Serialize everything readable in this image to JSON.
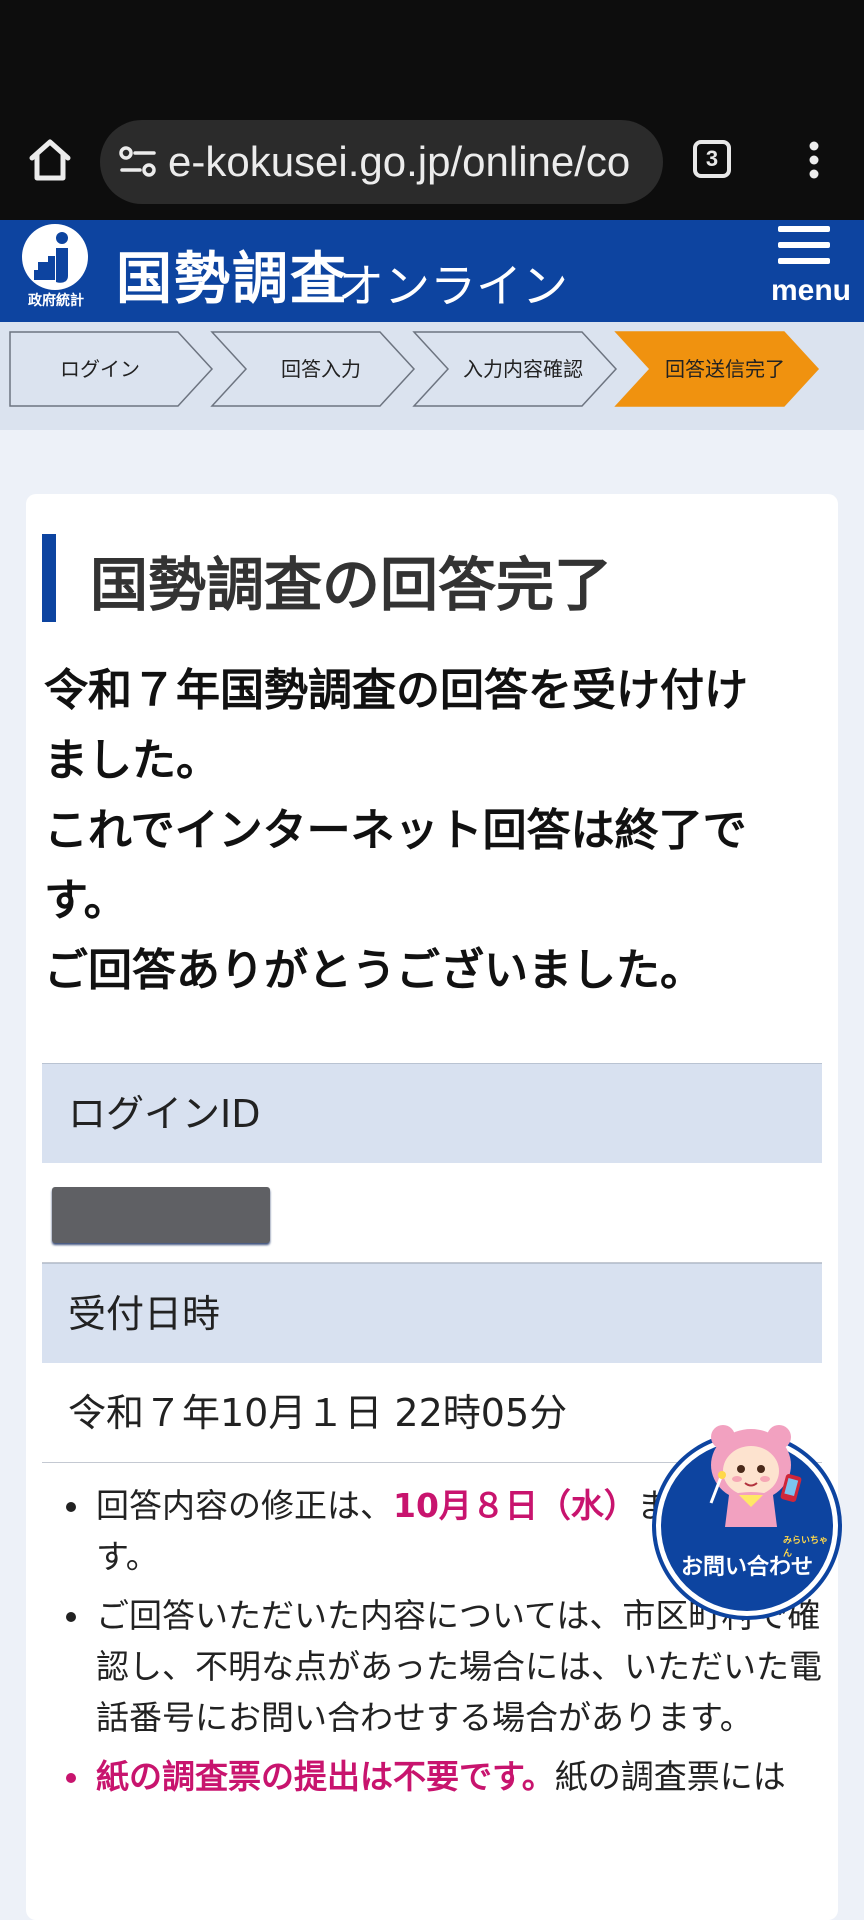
{
  "browser": {
    "url": "e-kokusei.go.jp/online/co",
    "tab_count": "3"
  },
  "header": {
    "logo_caption": "政府統計",
    "title": "国勢調査",
    "subtitle": "オンライン",
    "menu_label": "menu"
  },
  "steps": [
    {
      "label": "ログイン",
      "active": false
    },
    {
      "label": "回答入力",
      "active": false
    },
    {
      "label": "入力内容確認",
      "active": false
    },
    {
      "label": "回答送信完了",
      "active": true
    }
  ],
  "colors": {
    "brand_blue": "#0d44a0",
    "step_active": "#f0920f",
    "highlight": "#c8146e"
  },
  "main": {
    "heading": "国勢調査の回答完了",
    "message_lines": [
      "令和７年国勢調査の回答を受け付け",
      "ました。",
      "これでインターネット回答は終了で",
      "す。",
      "ご回答ありがとうございました。"
    ],
    "login_id_label": "ログインID",
    "received_label": "受付日時",
    "received_value": "令和７年10月１日 22時05分",
    "notes": {
      "n1_pre": "回答内容の修正は、",
      "n1_date": "10月８日（水）",
      "n1_post": "まで可能です。",
      "n2": "ご回答いただいた内容については、市区町村で確認し、不明な点があった場合には、いただいた電話番号にお問い合わせする場合があります。",
      "n3_bold": "紙の調査票の提出は不要です。",
      "n3_rest": "紙の調査票には"
    }
  },
  "contact": {
    "label": "お問い合わせ",
    "mascot_name": "みらいちゃん"
  }
}
